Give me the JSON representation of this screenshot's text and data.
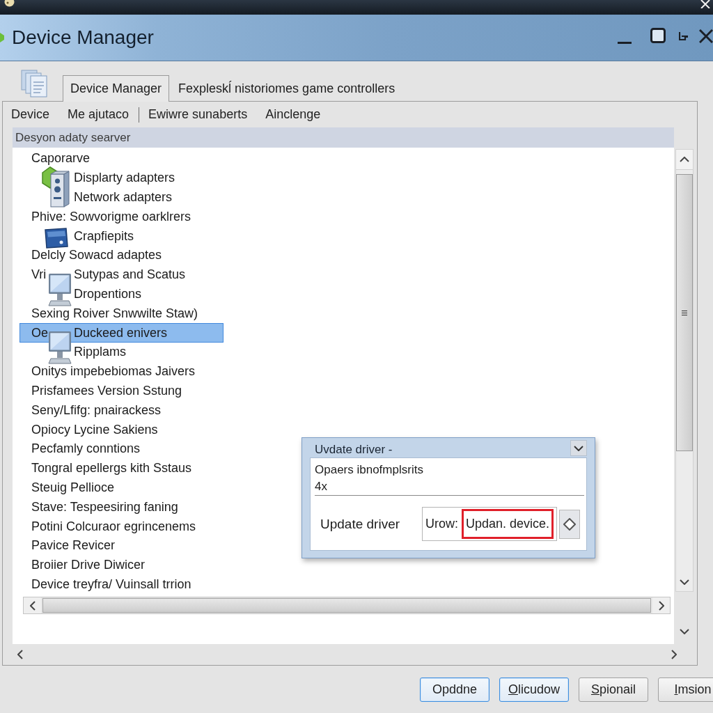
{
  "window": {
    "title": "Device Manager"
  },
  "tabs": [
    {
      "label": "Device Manager",
      "selected": true
    },
    {
      "label": "Fexpleskĺ nistoriomes game controllers",
      "selected": false
    }
  ],
  "menu": [
    {
      "kind": "item",
      "label": "Device"
    },
    {
      "kind": "item",
      "label": "Me ajutaco"
    },
    {
      "kind": "separator"
    },
    {
      "kind": "item",
      "label": "Ewiwre sunaberts"
    },
    {
      "kind": "item",
      "label": "Ainclenge"
    }
  ],
  "tree": {
    "header": "Desyon adaty searver",
    "items": [
      {
        "label": "Caporarve",
        "selected": false,
        "kind": "tower",
        "children": [
          {
            "label": "Displarty adapters",
            "selected": false
          },
          {
            "label": "Network adapters",
            "selected": false
          }
        ]
      },
      {
        "label": "Phive: Sowvorigme oarklrers",
        "selected": false,
        "kind": "card",
        "children": [
          {
            "label": "Crapfiepits",
            "selected": false
          }
        ]
      },
      {
        "label": "Delcly Sowacd adaptes",
        "selected": false,
        "kind": "plain"
      },
      {
        "label": "Vri",
        "selected": false,
        "kind": "monitor",
        "children": [
          {
            "label": "Sutypas and Scatus",
            "selected": false
          },
          {
            "label": "Dropentions",
            "selected": false
          }
        ]
      },
      {
        "label": "Sexing Roiver Snwwilte Staw)",
        "selected": false,
        "kind": "plain"
      },
      {
        "label": "Oe",
        "selected": false,
        "kind": "monitor",
        "children": [
          {
            "label": "Duckeed enivers",
            "selected": true
          },
          {
            "label": "Ripplams",
            "selected": false
          }
        ]
      },
      {
        "label": "Onitys impebebiomas Jaivers",
        "selected": false,
        "kind": "plain"
      },
      {
        "label": "Prisfamees Version Sstung",
        "selected": false,
        "kind": "plain"
      },
      {
        "label": "Seny/Lfifg: pnairackess",
        "selected": false,
        "kind": "plain"
      },
      {
        "label": "Opiocy Lycine Sakiens",
        "selected": false,
        "kind": "plain"
      },
      {
        "label": "Pecfamly conntions",
        "selected": false,
        "kind": "plain"
      },
      {
        "label": "Tongral epellergs kith Sstaus",
        "selected": false,
        "kind": "plain"
      },
      {
        "label": "Steuig Pellioce",
        "selected": false,
        "kind": "plain"
      },
      {
        "label": "Stave: Tespeesiring faning",
        "selected": false,
        "kind": "plain"
      },
      {
        "label": "Potini Colcuraor egrincenems",
        "selected": false,
        "kind": "plain"
      },
      {
        "label": "Pavice Revicer",
        "selected": false,
        "kind": "plain"
      },
      {
        "label": "Broiier Drive Diwicer",
        "selected": false,
        "kind": "plain"
      },
      {
        "label": "Device treyfra/ Vuinsall trrion",
        "selected": false,
        "kind": "plain"
      }
    ]
  },
  "dialog": {
    "title": "Uvdate driver -",
    "lines": [
      "Opaers ibnofmplsrits",
      "4x"
    ],
    "field_label": "Update driver",
    "field": {
      "prefix": "Urow:",
      "value": "Updan. device.",
      "highlighted": true
    }
  },
  "buttons": [
    {
      "label": "Opddne",
      "highlighted": true,
      "mnemonic": false
    },
    {
      "label": "Olicudow",
      "highlighted": true,
      "mnemonic": true
    },
    {
      "label": "Spionail",
      "highlighted": false,
      "mnemonic": true
    },
    {
      "label": "Imsion",
      "highlighted": false,
      "mnemonic": true
    }
  ]
}
